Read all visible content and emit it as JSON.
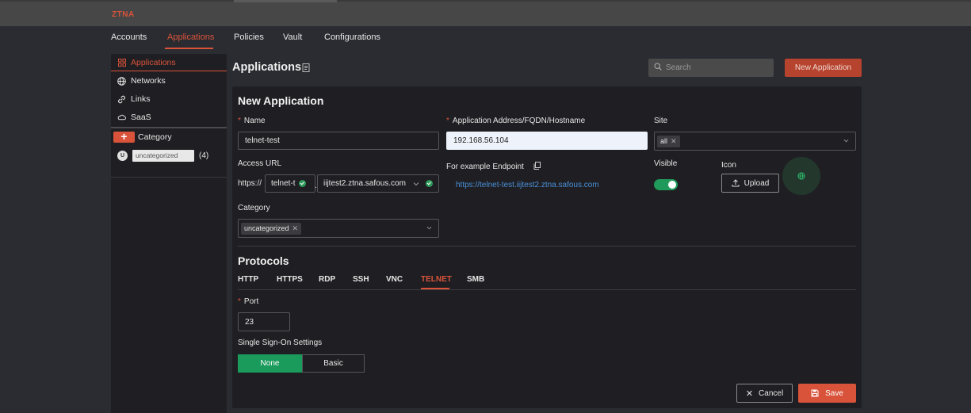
{
  "brand": "ZTNA",
  "nav": [
    "Accounts",
    "Applications",
    "Policies",
    "Vault",
    "Configurations"
  ],
  "sidebar": {
    "items": [
      "Applications",
      "Networks",
      "Links",
      "SaaS"
    ],
    "category_label": "Category",
    "category_add": "+",
    "category_avatar": "U",
    "category_name": "uncategorized",
    "category_count": "(4)"
  },
  "page": {
    "title": "Applications",
    "search_placeholder": "Search",
    "new_button": "New Application"
  },
  "form": {
    "title": "New Application",
    "name_label": "Name",
    "name_value": "telnet-test",
    "address_label": "Application Address/FQDN/Hostname",
    "address_value": "192.168.56.104",
    "site_label": "Site",
    "site_tag": "all",
    "access_url_label": "Access URL",
    "url_prefix": "https://",
    "subdomain": "telnet-t",
    "dot": ".",
    "domain": "iijtest2.ztna.safous.com",
    "endpoint_label": "For example Endpoint",
    "endpoint_url": "https://telnet-test.iijtest2.ztna.safous.com",
    "visible_label": "Visible",
    "visible_on": true,
    "icon_label": "Icon",
    "upload_button": "Upload",
    "category_label": "Category",
    "category_tag": "uncategorized"
  },
  "protocols": {
    "title": "Protocols",
    "tabs": [
      "HTTP",
      "HTTPS",
      "RDP",
      "SSH",
      "VNC",
      "TELNET",
      "SMB"
    ],
    "active": "TELNET",
    "port_label": "Port",
    "port_value": "23",
    "sso_label": "Single Sign-On Settings",
    "sso_options": [
      "None",
      "Basic"
    ],
    "sso_selected": "None"
  },
  "actions": {
    "cancel": "Cancel",
    "save": "Save"
  },
  "colors": {
    "accent": "#d9533a",
    "success": "#1a9a5b",
    "link": "#4a90d9"
  }
}
